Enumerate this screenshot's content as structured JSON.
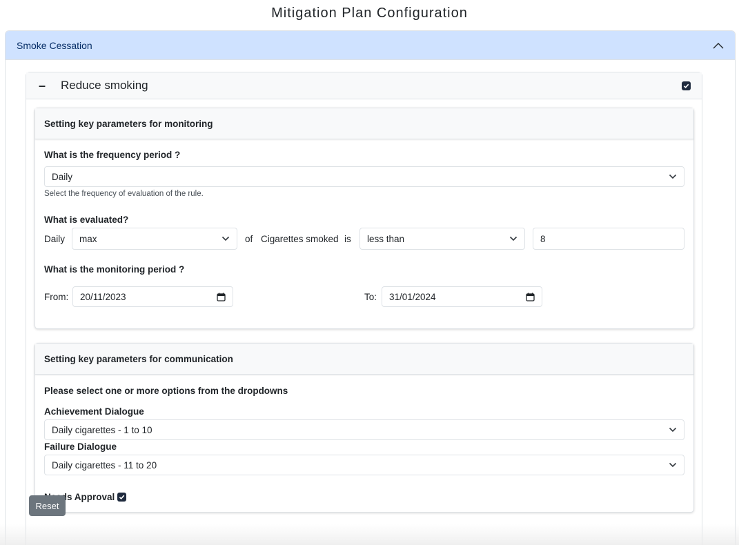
{
  "page": {
    "title": "Mitigation Plan Configuration"
  },
  "accordion": {
    "label": "Smoke Cessation",
    "expanded": true
  },
  "goal": {
    "toggle": "–",
    "title": "Reduce smoking",
    "checked": true
  },
  "monitoring": {
    "header": "Setting key parameters for monitoring",
    "frequency": {
      "label": "What is the frequency period ?",
      "value": "Daily",
      "helper": "Select the frequency of evaluation of the rule."
    },
    "evaluated": {
      "label": "What is evaluated?",
      "period_text": "Daily",
      "aggregate": "max",
      "of_text": "of",
      "metric": "Cigarettes smoked",
      "is_text": "is",
      "comparator": "less than",
      "threshold": "8"
    },
    "period": {
      "label": "What is the monitoring period ?",
      "from_label": "From:",
      "from_value": "20/11/2023",
      "to_label": "To:",
      "to_value": "31/01/2024"
    }
  },
  "communication": {
    "header": "Setting key parameters for communication",
    "instruction": "Please select one or more options from the dropdowns",
    "achievement": {
      "label": "Achievement Dialogue",
      "value": "Daily cigarettes - 1 to 10"
    },
    "failure": {
      "label": "Failure Dialogue",
      "value": "Daily cigarettes - 11 to 20"
    },
    "approval": {
      "label": "Needs Approval",
      "checked": true
    }
  },
  "actions": {
    "reset_label": "Reset"
  },
  "colors": {
    "accordion_header_bg": "#cfe2ff",
    "checkbox_fill": "#1f2b3e",
    "reset_button_bg": "#6c757d"
  },
  "icons": [
    "chevron-up-icon",
    "chevron-down-icon",
    "calendar-icon",
    "checkmark-icon"
  ]
}
